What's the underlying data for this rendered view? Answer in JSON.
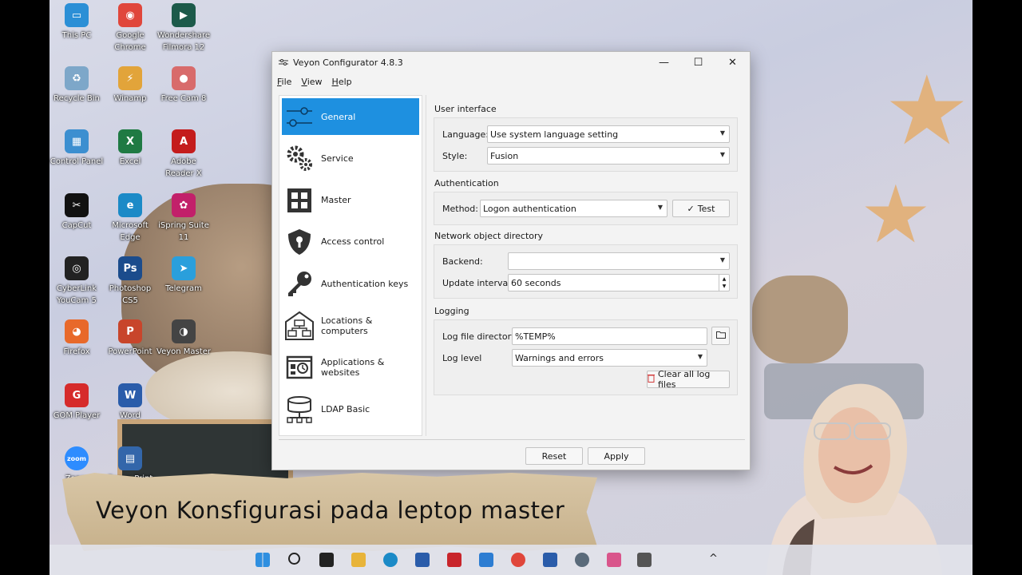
{
  "window": {
    "title": "Veyon Configurator 4.8.3",
    "controls": {
      "minimize": "—",
      "maximize": "☐",
      "close": "✕"
    }
  },
  "menu": [
    "File",
    "View",
    "Help"
  ],
  "nav": [
    {
      "label": "General",
      "icon": "sliders-icon",
      "active": true
    },
    {
      "label": "Service",
      "icon": "gears-icon"
    },
    {
      "label": "Master",
      "icon": "grid-icon"
    },
    {
      "label": "Access control",
      "icon": "shield-lock-icon"
    },
    {
      "label": "Authentication keys",
      "icon": "key-icon"
    },
    {
      "label": "Locations & computers",
      "icon": "network-icon"
    },
    {
      "label": "Applications & websites",
      "icon": "app-clock-icon"
    },
    {
      "label": "LDAP Basic",
      "icon": "database-icon"
    }
  ],
  "sections": {
    "ui": {
      "title": "User interface",
      "language_label": "Language:",
      "language_value": "Use system language setting",
      "style_label": "Style:",
      "style_value": "Fusion"
    },
    "auth": {
      "title": "Authentication",
      "method_label": "Method:",
      "method_value": "Logon authentication",
      "test_label": "Test"
    },
    "network": {
      "title": "Network object directory",
      "backend_label": "Backend:",
      "backend_value": "",
      "interval_label": "Update interval:",
      "interval_value": "60 seconds"
    },
    "logging": {
      "title": "Logging",
      "dir_label": "Log file directory",
      "dir_value": "%TEMP%",
      "level_label": "Log level",
      "level_value": "Warnings and errors",
      "clear_label": "Clear all log files"
    }
  },
  "footer": {
    "reset": "Reset",
    "apply": "Apply"
  },
  "caption": "Veyon Konsfigurasi pada leptop master",
  "desktop_icons": [
    {
      "label": "This PC",
      "color": "#2b8fd6",
      "glyph": "▭"
    },
    {
      "label": "Google\nChrome",
      "color": "#e0463b",
      "glyph": "◉"
    },
    {
      "label": "Wondershare\nFilmora 12",
      "color": "#1c5a4a",
      "glyph": "▶"
    },
    {
      "label": "Recycle Bin",
      "color": "#7da7c9",
      "glyph": "♻"
    },
    {
      "label": "Winamp",
      "color": "#e2a43a",
      "glyph": "⚡"
    },
    {
      "label": "Free Cam 8",
      "color": "#d86b6b",
      "glyph": "●"
    },
    {
      "label": "Control Panel",
      "color": "#3c8fd0",
      "glyph": "▦"
    },
    {
      "label": "Excel",
      "color": "#1f7a43",
      "glyph": "X"
    },
    {
      "label": "Adobe\nReader X",
      "color": "#c41c1c",
      "glyph": "A"
    },
    {
      "label": "CapCut",
      "color": "#111111",
      "glyph": "✂"
    },
    {
      "label": "Microsoft\nEdge",
      "color": "#1b8ac7",
      "glyph": "e"
    },
    {
      "label": "iSpring Suite\n11",
      "color": "#c2206a",
      "glyph": "✿"
    },
    {
      "label": "CyberLink\nYouCam 5",
      "color": "#222222",
      "glyph": "◎"
    },
    {
      "label": "Photoshop\nCS5",
      "color": "#1b4c8c",
      "glyph": "Ps"
    },
    {
      "label": "Telegram",
      "color": "#2a9fdc",
      "glyph": "➤"
    },
    {
      "label": "Firefox",
      "color": "#e8692a",
      "glyph": "◕"
    },
    {
      "label": "PowerPoint",
      "color": "#c8452b",
      "glyph": "P"
    },
    {
      "label": "Veyon Master",
      "color": "#444444",
      "glyph": "◑"
    },
    {
      "label": "GOM Player",
      "color": "#d62b2b",
      "glyph": "G"
    },
    {
      "label": "Word",
      "color": "#2a5caa",
      "glyph": "W"
    },
    {
      "label": "",
      "color": "",
      "glyph": ""
    },
    {
      "label": "Zoom",
      "color": "#2d8cff",
      "glyph": "zoom"
    },
    {
      "label": "Epson Print",
      "color": "#3366aa",
      "glyph": "▤"
    }
  ],
  "colors": {
    "accent": "#1e90e0",
    "window_bg": "#f3f3f3",
    "caption_paper": "#d2bf9c"
  }
}
